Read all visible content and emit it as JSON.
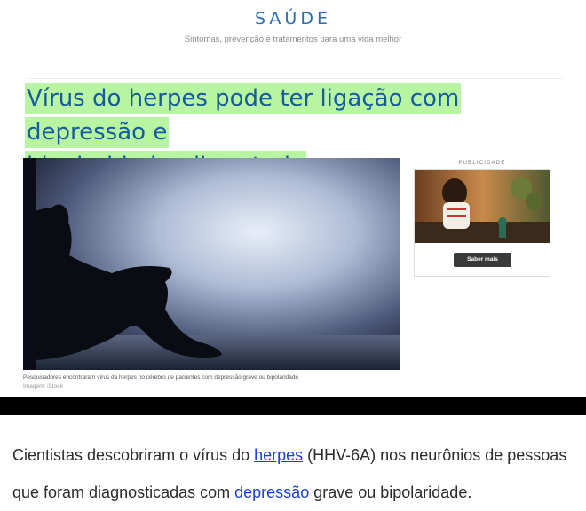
{
  "header": {
    "brand": "SAÚDE",
    "tagline": "Sintomas, prevenção e tratamentos para uma vida melhor"
  },
  "article": {
    "headline_line1": "Vírus do herpes pode ter ligação com depressão e",
    "headline_line2": "bipolaridade, diz estudo",
    "image_caption": "Pesquisadores encontraram vírus da herpes no cérebro de pacientes com depressão grave ou bipolaridade",
    "image_credit": "Imagem: iStock",
    "body": {
      "text1": "Cientistas descobriram o vírus do ",
      "link1": "herpes",
      "text2": " (HHV-6A) nos neurônios de pessoas que foram diagnosticadas com ",
      "link2": "depressão ",
      "text3": "grave ou bipolaridade."
    },
    "highlight_color": "#b8f5a3",
    "link_color": "#1a40d8"
  },
  "ad": {
    "label": "PUBLICIDADE",
    "button_label": "Saber mais"
  }
}
